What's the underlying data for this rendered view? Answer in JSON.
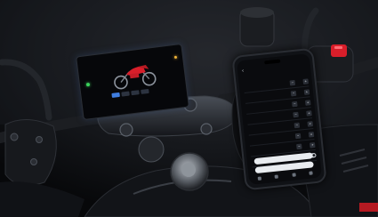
{
  "dashboard": {
    "brand": "",
    "mode": "",
    "track_label": "",
    "tabs": [
      "",
      "",
      "",
      ""
    ]
  },
  "phone": {
    "title": "",
    "section": "",
    "rows": [
      {
        "label": "",
        "value": "",
        "kind": "stepper"
      },
      {
        "label": "",
        "value": "",
        "kind": "stepper"
      },
      {
        "label": "",
        "value": "",
        "kind": "stepper"
      },
      {
        "label": "",
        "value": "",
        "kind": "stepper"
      },
      {
        "label": "",
        "value": "",
        "kind": "stepper"
      },
      {
        "label": "",
        "value": "",
        "kind": "stepper"
      },
      {
        "label": "",
        "value": "",
        "kind": "stepper"
      },
      {
        "label": "",
        "value": "",
        "kind": "toggle"
      }
    ],
    "buttons": [
      "",
      ""
    ]
  },
  "colors": {
    "night_sky": "#0b0d12",
    "bike_red": "#d81e2a",
    "accent_blue": "#3f7de0",
    "led_green": "#3ad15b",
    "screen_glow": "#5d8fd6"
  }
}
